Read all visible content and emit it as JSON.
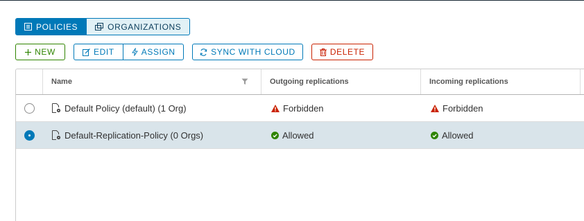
{
  "tabs": [
    {
      "label": "POLICIES",
      "icon": "grid-icon",
      "active": true
    },
    {
      "label": "ORGANIZATIONS",
      "icon": "organization-icon",
      "active": false
    }
  ],
  "toolbar": {
    "new_label": "NEW",
    "edit_label": "EDIT",
    "assign_label": "ASSIGN",
    "sync_label": "SYNC WITH CLOUD",
    "delete_label": "DELETE"
  },
  "grid": {
    "columns": [
      "Name",
      "Outgoing replications",
      "Incoming replications"
    ],
    "rows": [
      {
        "name": "Default Policy (default) (1 Org)",
        "outgoing": "Forbidden",
        "outgoing_status": "error",
        "incoming": "Forbidden",
        "incoming_status": "error",
        "selected": false
      },
      {
        "name": "Default-Replication-Policy (0 Orgs)",
        "outgoing": "Allowed",
        "outgoing_status": "success",
        "incoming": "Allowed",
        "incoming_status": "success",
        "selected": true
      }
    ]
  },
  "colors": {
    "primary": "#0079b8",
    "success": "#2f8400",
    "danger": "#c92100",
    "selected_row": "#d9e4ea"
  }
}
